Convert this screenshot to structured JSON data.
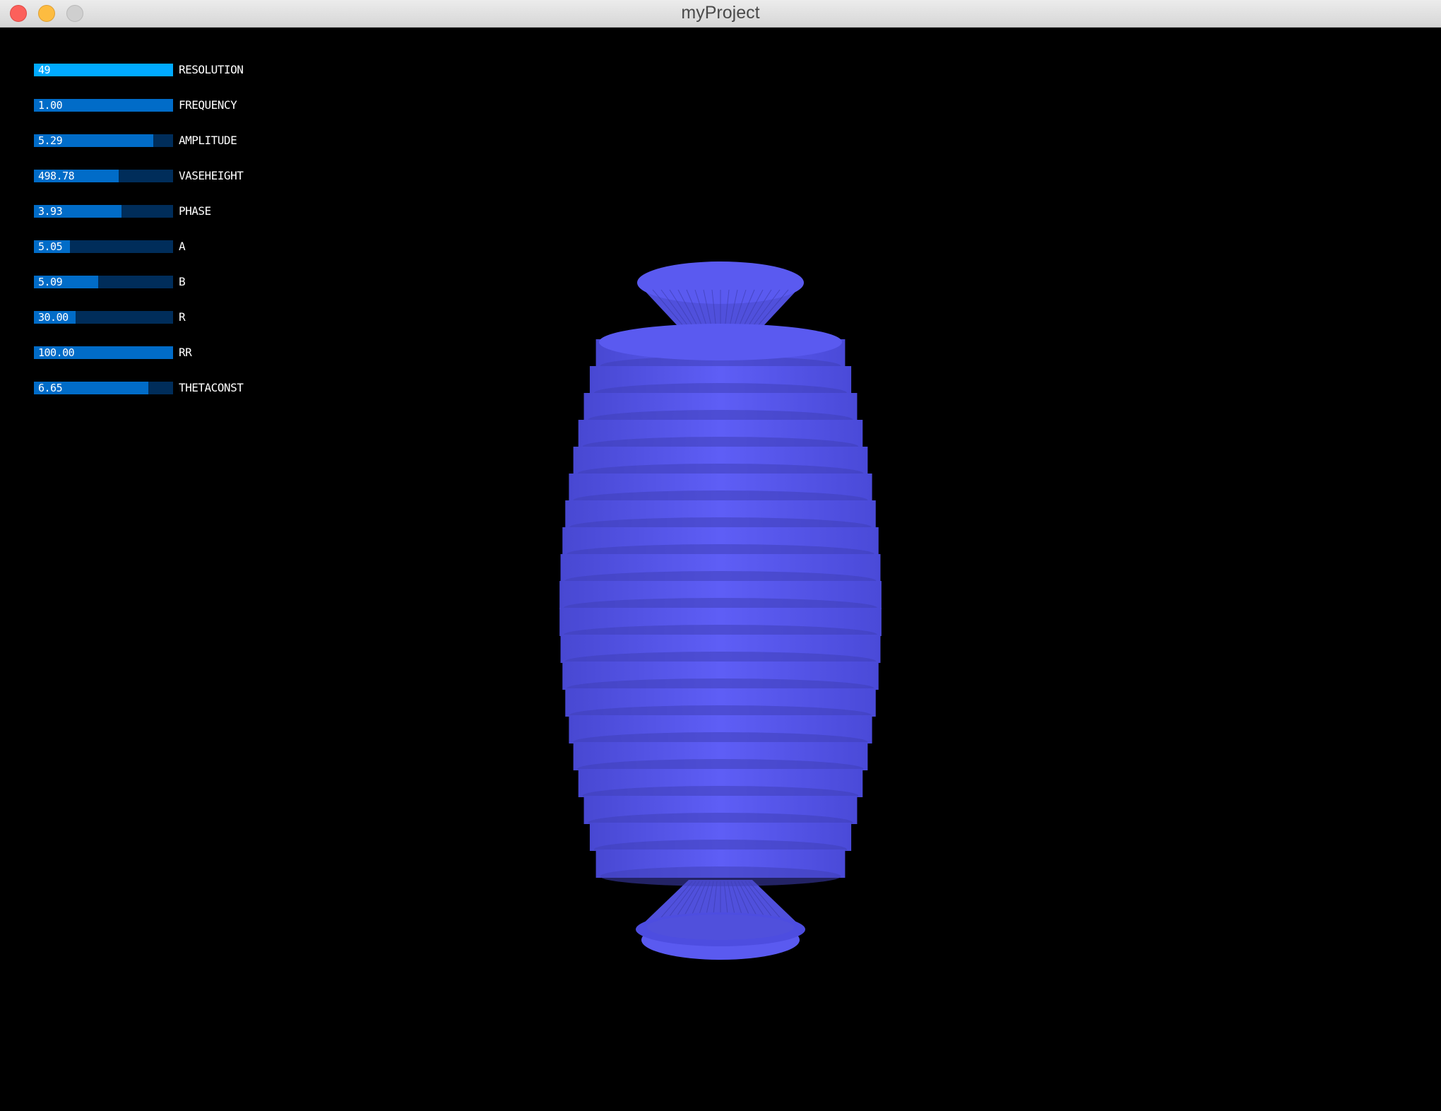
{
  "window": {
    "title": "myProject"
  },
  "colors": {
    "background": "#000000",
    "slider_track": "#002d5a",
    "slider_fill": "#016cc8",
    "slider_fill_active": "#00aaff",
    "vase": "#5a5af0"
  },
  "sliders": [
    {
      "label": "RESOLUTION",
      "value": "49",
      "fill_fraction": 1.0,
      "active": true
    },
    {
      "label": "FREQUENCY",
      "value": "1.00",
      "fill_fraction": 1.0,
      "active": false
    },
    {
      "label": "AMPLITUDE",
      "value": "5.29",
      "fill_fraction": 0.86,
      "active": false
    },
    {
      "label": "VASEHEIGHT",
      "value": "498.78",
      "fill_fraction": 0.61,
      "active": false
    },
    {
      "label": "PHASE",
      "value": "3.93",
      "fill_fraction": 0.63,
      "active": false
    },
    {
      "label": "A",
      "value": "5.05",
      "fill_fraction": 0.26,
      "active": false
    },
    {
      "label": "B",
      "value": "5.09",
      "fill_fraction": 0.46,
      "active": false
    },
    {
      "label": "R",
      "value": "30.00",
      "fill_fraction": 0.3,
      "active": false
    },
    {
      "label": "RR",
      "value": "100.00",
      "fill_fraction": 1.0,
      "active": false
    },
    {
      "label": "THETACONST",
      "value": "6.65",
      "fill_fraction": 0.82,
      "active": false
    }
  ]
}
